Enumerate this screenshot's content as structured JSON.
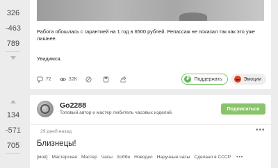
{
  "votes": [
    {
      "score": "326",
      "score_neg": "-463",
      "score_total": "789"
    },
    {
      "score": "134",
      "score_neg": "-571",
      "score_total": "705"
    }
  ],
  "post1": {
    "paragraph1": "Работа обошлась с гарантией на 1 год в 6500 рублей. Репассаж не показал так как это уже лишнее.",
    "paragraph2": "Увидимся.",
    "comments": "72",
    "views": "32K",
    "support_label": "Поддержать",
    "ruble_symbol": "₽",
    "emotions_label": "Эмоции",
    "icons": [
      "comment-icon",
      "eye-icon",
      "block-icon",
      "bookmark-icon",
      "share-icon"
    ]
  },
  "post2": {
    "author": "Go2288",
    "author_desc": "Топовый автор и мастер любитель часовых изделий.",
    "subscribe_label": "Подписаться",
    "date": "29 дней назад",
    "more": "•••",
    "title": "Близнецы!",
    "tags": [
      "[моё]",
      "Мастерская",
      "Мастер",
      "Часы",
      "Хобби",
      "Новодел",
      "Наручные часы",
      "Сделано в СССР"
    ],
    "tags_more": "•••"
  },
  "colors": {
    "accent_green": "#8ac46a",
    "background": "#ececec"
  }
}
